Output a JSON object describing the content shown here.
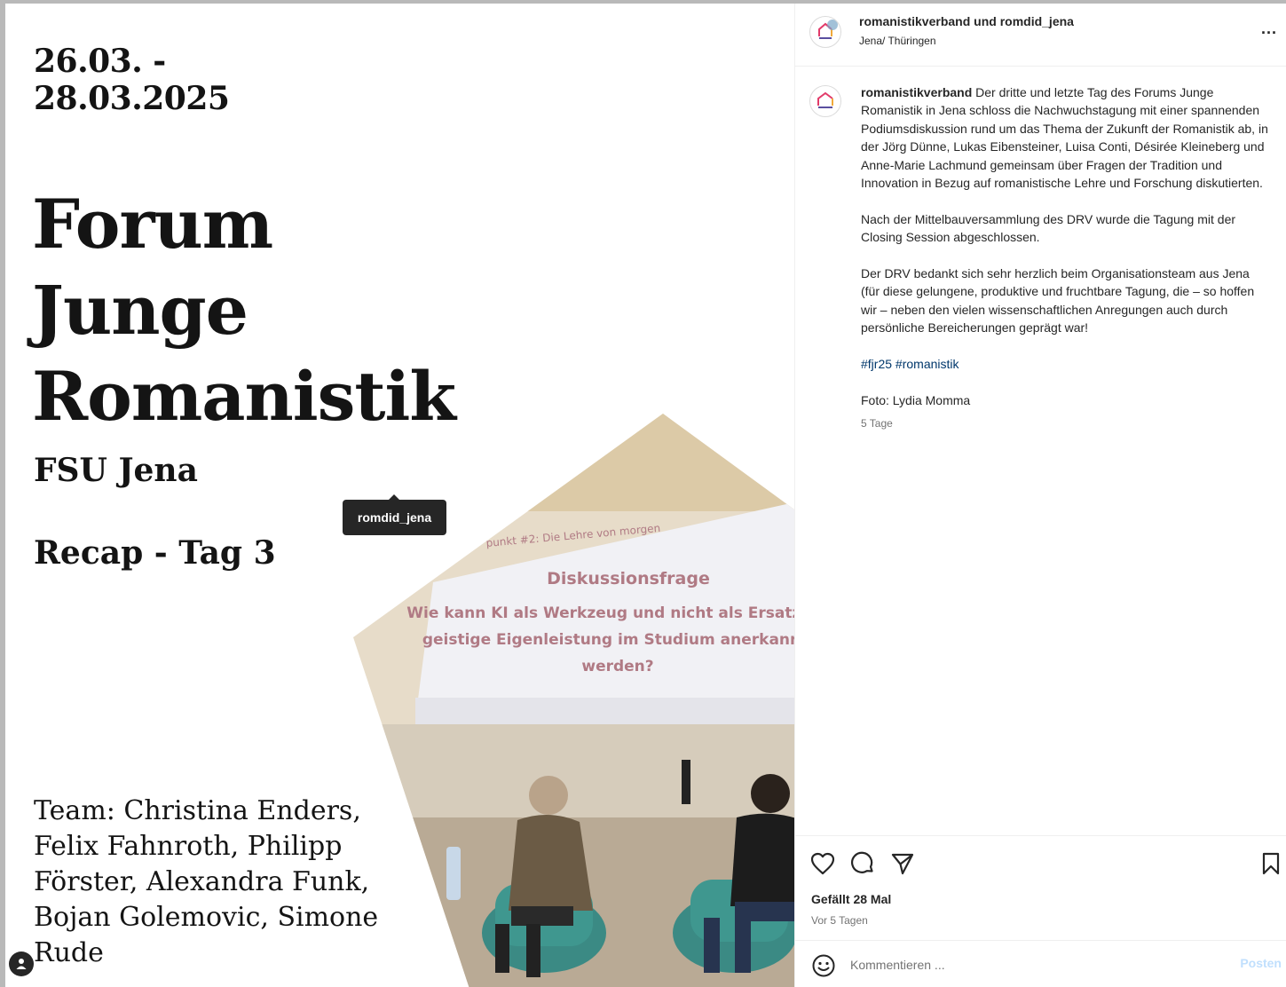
{
  "image": {
    "date_range": "26.03. -\n28.03.2025",
    "title": "Forum\nJunge\nRomanistik",
    "subtitle": "FSU Jena",
    "recap": "Recap - Tag 3",
    "team": "Team: Christina Enders, Felix Fahnroth, Philipp Förster, Alexandra Funk, Bojan Golemovic, Simone Rude",
    "tag_tooltip": "romdid_jena",
    "slide": {
      "header": "punkt #2: Die Lehre von morgen",
      "heading": "Diskussionsfrage",
      "question": "Wie kann KI als Werkzeug und nicht als Ersatz fü\ngeistige Eigenleistung im Studium anerkannt\nwerden?"
    }
  },
  "header": {
    "authors": "romanistikverband und romdid_jena",
    "location": "Jena/ Thüringen",
    "more": "..."
  },
  "caption": {
    "username": "romanistikverband",
    "p1": "Der dritte und letzte Tag des Forums Junge Romanistik in Jena schloss die Nachwuchstagung mit einer spannenden Podiumsdiskussion rund um das Thema der Zukunft der Romanistik ab, in der Jörg Dünne, Lukas Eibensteiner, Luisa Conti, Désirée Kleineberg und Anne-Marie Lachmund gemeinsam über Fragen der Tradition und Innovation in Bezug auf romanistische Lehre und Forschung diskutierten.",
    "p2": "Nach der Mittelbauversammlung des DRV wurde die Tagung mit der Closing Session abgeschlossen.",
    "p3": "Der DRV bedankt sich sehr herzlich beim Organisationsteam aus Jena (für diese gelungene, produktive und fruchtbare Tagung, die – so hoffen wir – neben den vielen wissenschaftlichen Anregungen auch durch persönliche Bereicherungen geprägt war!",
    "hashtag1": "#fjr25",
    "hashtag2": "#romanistik",
    "photo_credit": "Foto: Lydia Momma",
    "time": "5 Tage"
  },
  "actions": {
    "icons": [
      "heart-icon",
      "comment-icon",
      "share-icon",
      "bookmark-icon"
    ],
    "likes": "Gefällt 28 Mal",
    "date": "Vor 5 Tagen"
  },
  "comment": {
    "placeholder": "Kommentieren ...",
    "post_label": "Posten"
  },
  "colors": {
    "link": "#00376b",
    "post_disabled": "#c0dffd",
    "tooltip_bg": "#262626",
    "slide_text": "#b07a84"
  }
}
